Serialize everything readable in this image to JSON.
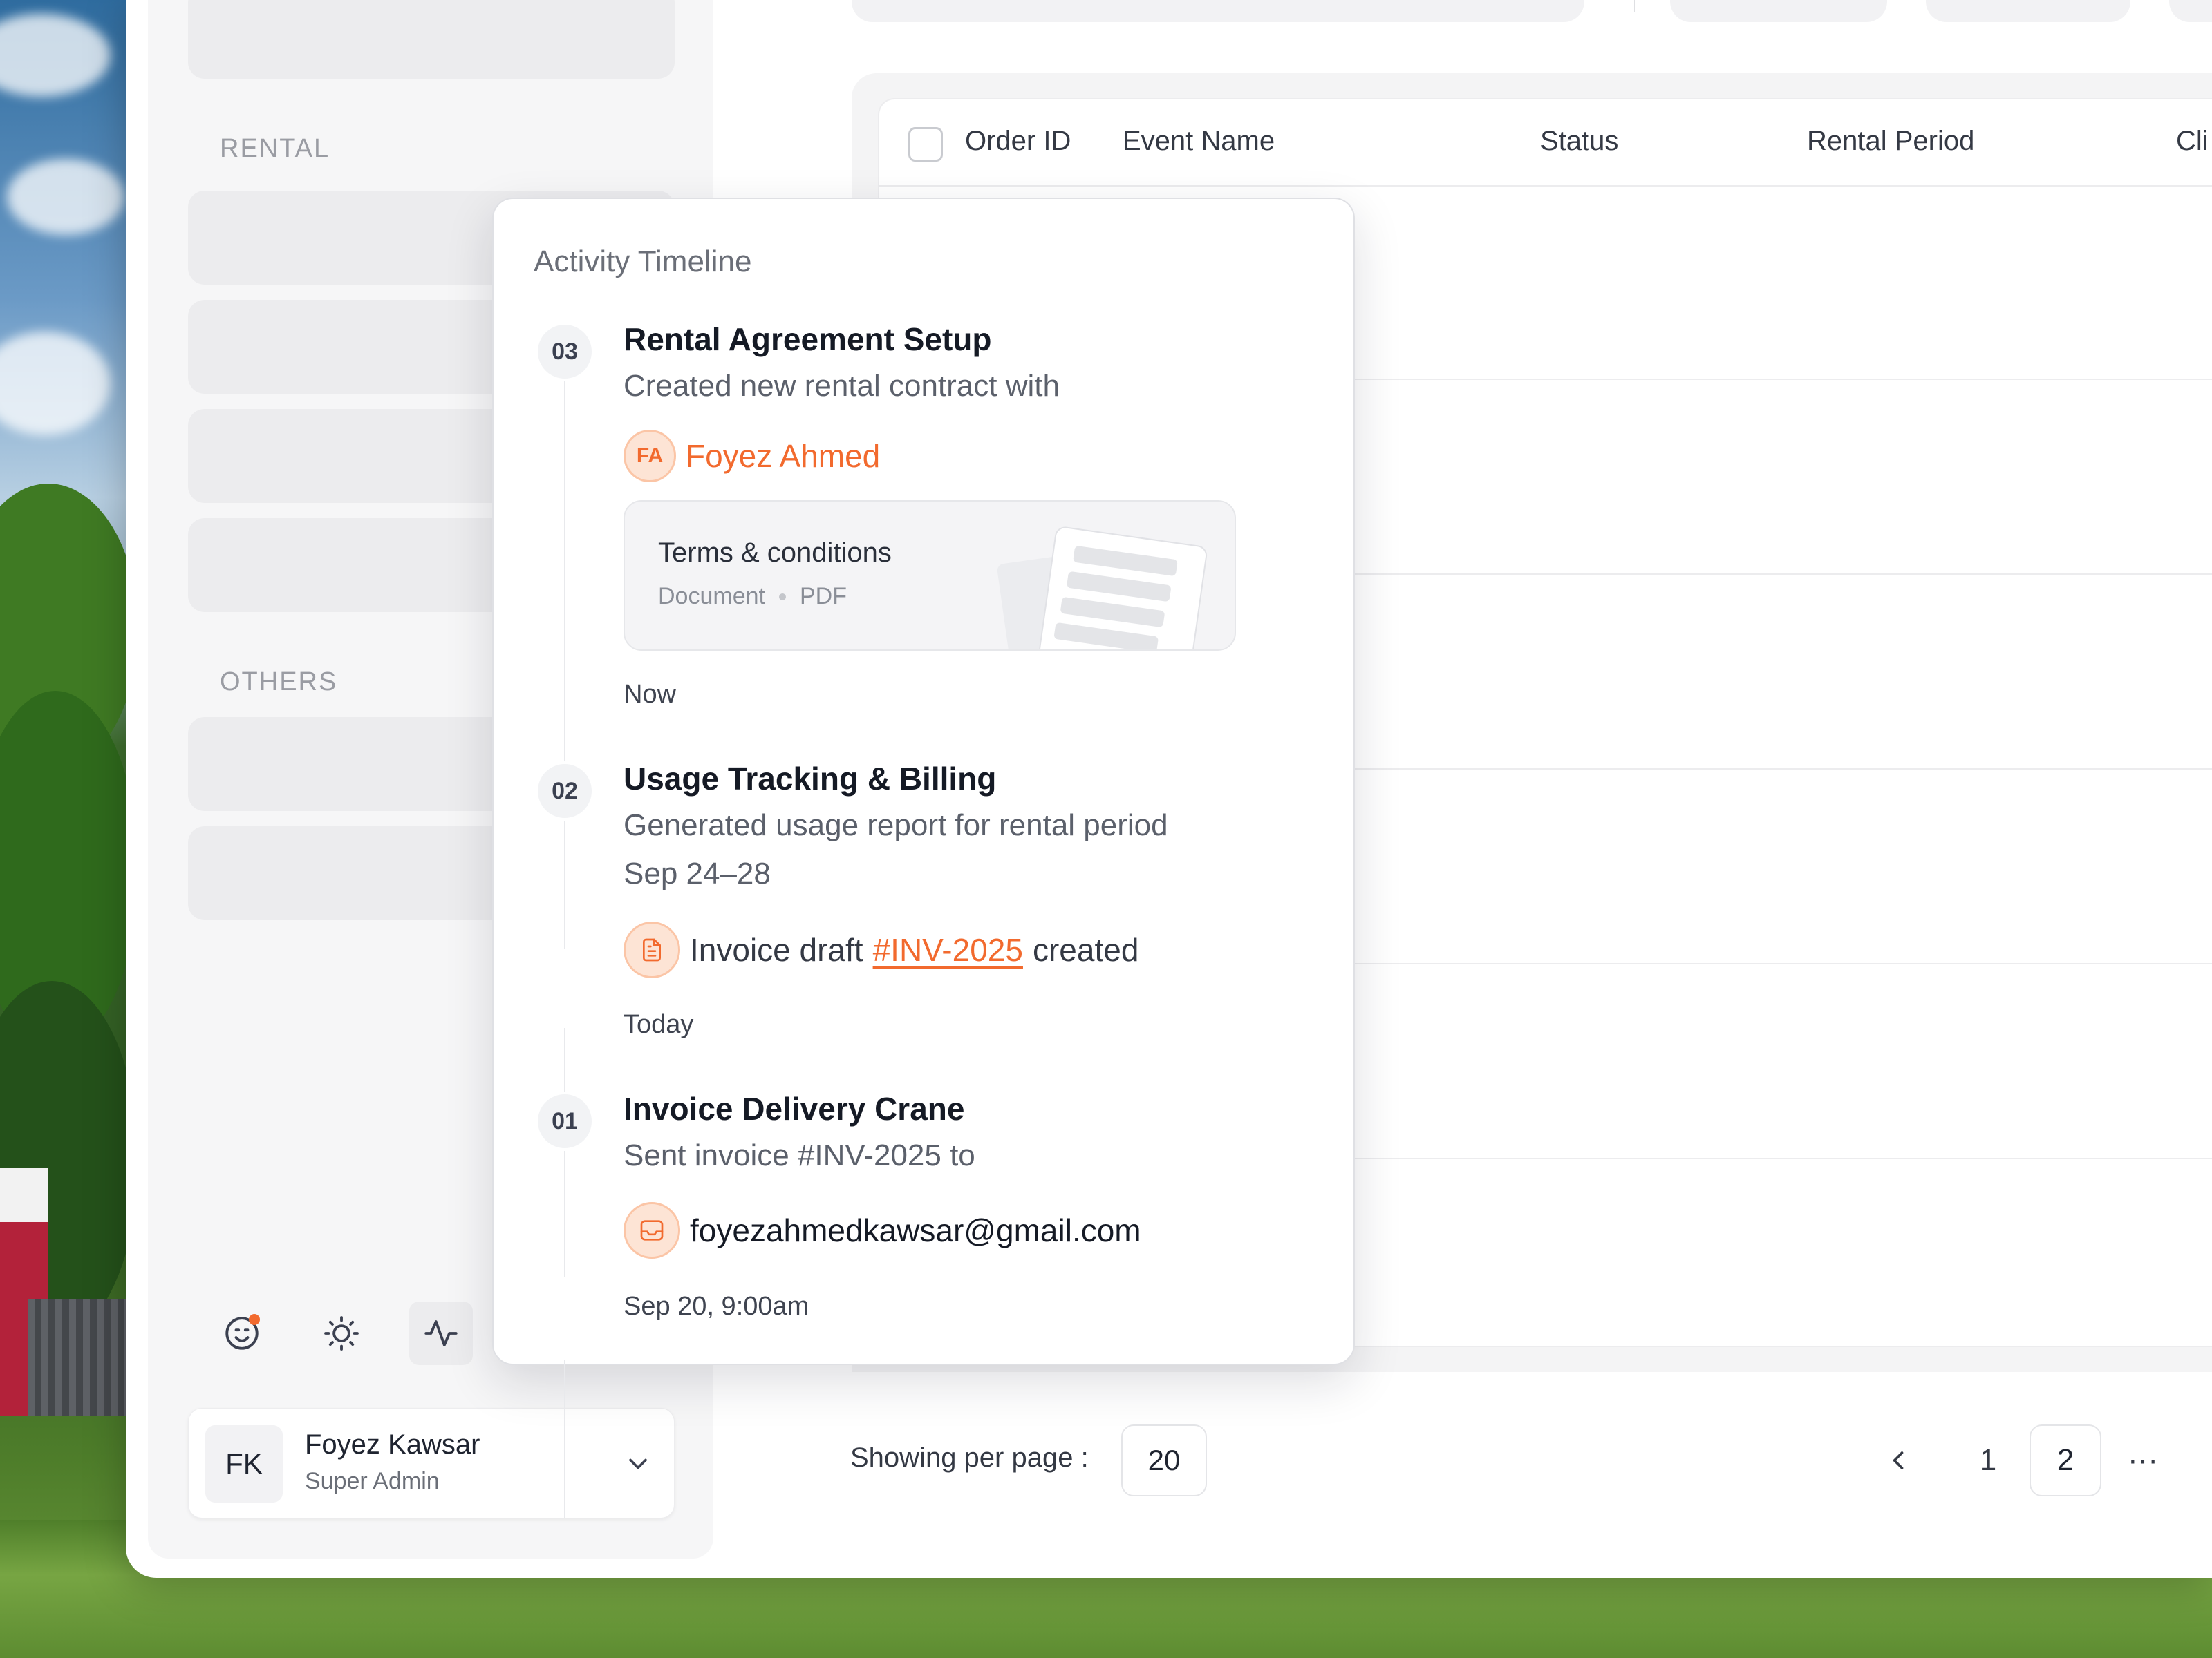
{
  "sidebar": {
    "sections": {
      "rental": "RENTAL",
      "others": "OTHERS"
    },
    "bottom_icons": [
      "smiley-notification-icon",
      "sun-icon",
      "activity-icon"
    ],
    "user": {
      "initials": "FK",
      "name": "Foyez Kawsar",
      "role": "Super Admin"
    }
  },
  "table": {
    "columns": [
      "Order ID",
      "Event Name",
      "Status",
      "Rental Period",
      "Cli"
    ]
  },
  "pagination": {
    "label": "Showing per page :",
    "per_page": "20",
    "pages": [
      "1",
      "2"
    ],
    "current_page": "2",
    "ellipsis": "···"
  },
  "activity": {
    "title": "Activity Timeline",
    "items": [
      {
        "num": "03",
        "heading": "Rental Agreement Setup",
        "desc": "Created new rental contract with",
        "person_initials": "FA",
        "person_name": "Foyez Ahmed",
        "doc_title": "Terms & conditions",
        "doc_type": "Document",
        "doc_ext": "PDF",
        "time": "Now"
      },
      {
        "num": "02",
        "heading": "Usage Tracking & Billing",
        "desc_line1": "Generated usage report for rental period",
        "desc_line2": "Sep 24–28",
        "chip_prefix": "Invoice draft",
        "chip_link": "#INV-2025",
        "chip_suffix": "created",
        "time": "Today"
      },
      {
        "num": "01",
        "heading": "Invoice Delivery Crane",
        "desc": "Sent invoice #INV-2025 to",
        "email": "foyezahmedkawsar@gmail.com",
        "time": "Sep 20, 9:00am"
      }
    ]
  },
  "colors": {
    "accent": "#f26a2e",
    "accent_soft": "#fde4d5",
    "text_primary": "#151a25",
    "text_muted": "#6b6f78",
    "sidebar_bg": "#f6f6f7"
  }
}
